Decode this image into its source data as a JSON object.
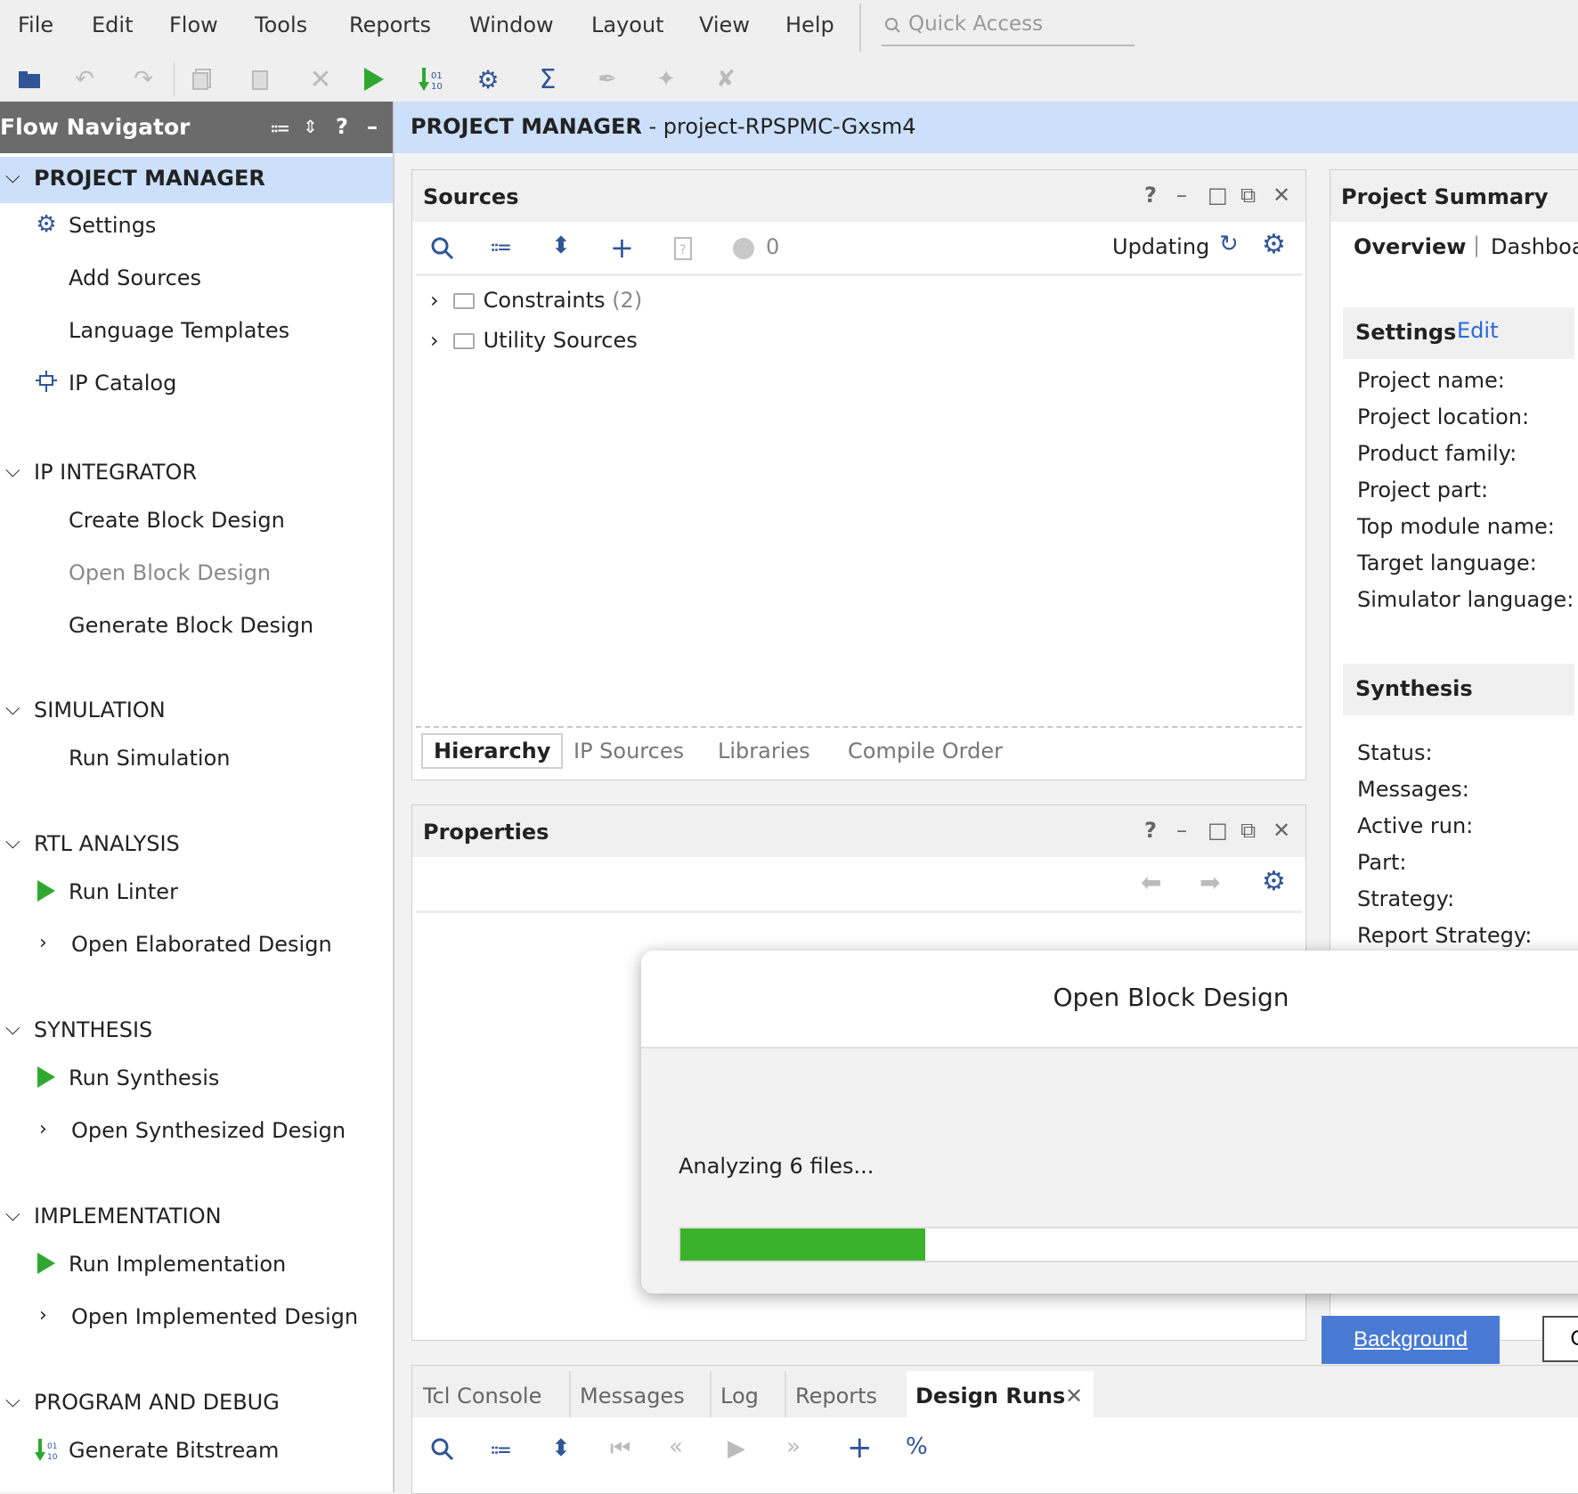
{
  "menu": [
    "File",
    "Edit",
    "Flow",
    "Tools",
    "Reports",
    "Window",
    "Layout",
    "View",
    "Help"
  ],
  "quick_access": {
    "placeholder": "Quick Access"
  },
  "toolbar": {
    "icons": [
      "open-project-icon",
      "undo-icon",
      "redo-icon",
      "copy-icon",
      "paste-icon",
      "delete-icon",
      "run-icon",
      "generate-bitstream-icon",
      "settings-icon",
      "sigma-icon",
      "disabled-tool-1-icon",
      "disabled-tool-2-icon",
      "disabled-tool-3-icon"
    ]
  },
  "flow_navigator": {
    "title": "Flow Navigator",
    "sections": [
      {
        "label": "PROJECT MANAGER",
        "items": [
          "Settings",
          "Add Sources",
          "Language Templates",
          "IP Catalog"
        ]
      },
      {
        "label": "IP INTEGRATOR",
        "items": [
          "Create Block Design",
          "Open Block Design",
          "Generate Block Design"
        ]
      },
      {
        "label": "SIMULATION",
        "items": [
          "Run Simulation"
        ]
      },
      {
        "label": "RTL ANALYSIS",
        "items": [
          "Run Linter",
          "Open Elaborated Design"
        ]
      },
      {
        "label": "SYNTHESIS",
        "items": [
          "Run Synthesis",
          "Open Synthesized Design"
        ]
      },
      {
        "label": "IMPLEMENTATION",
        "items": [
          "Run Implementation",
          "Open Implemented Design"
        ]
      },
      {
        "label": "PROGRAM AND DEBUG",
        "items": [
          "Generate Bitstream"
        ]
      }
    ]
  },
  "pm_header": {
    "title": "PROJECT MANAGER",
    "subtitle": " - project-RPSPMC-Gxsm4"
  },
  "sources": {
    "title": "Sources",
    "count": "0",
    "status": "Updating",
    "tree": [
      {
        "label": "Constraints",
        "count": "(2)"
      },
      {
        "label": "Utility Sources",
        "count": ""
      }
    ],
    "tabs": [
      "Hierarchy",
      "IP Sources",
      "Libraries",
      "Compile Order"
    ]
  },
  "properties": {
    "title": "Properties"
  },
  "summary": {
    "title": "Project Summary",
    "tabs": [
      "Overview",
      "Dashboa"
    ],
    "settings": {
      "title": "Settings",
      "edit": "Edit",
      "labels": [
        "Project name:",
        "Project location:",
        "Product family:",
        "Project part:",
        "Top module name:",
        "Target language:",
        "Simulator language:"
      ]
    },
    "synthesis": {
      "title": "Synthesis",
      "labels": [
        "Status:",
        "Messages:",
        "Active run:",
        "Part:",
        "Strategy:",
        "Report Strategy:"
      ]
    }
  },
  "dialog": {
    "title": "Open Block Design",
    "message": "Analyzing 6 files...",
    "progress": 0.26,
    "background_button": "Background",
    "cancel_button": "C"
  },
  "console": {
    "tabs": [
      "Tcl Console",
      "Messages",
      "Log",
      "Reports",
      "Design Runs"
    ]
  },
  "colors": {
    "accent": "#4a7bd4",
    "progress": "#3cb22c",
    "header_active": "#cce0fc",
    "nav_header": "#6b6b6b",
    "run_green": "#2fa82f",
    "icon_blue": "#2f5597"
  }
}
